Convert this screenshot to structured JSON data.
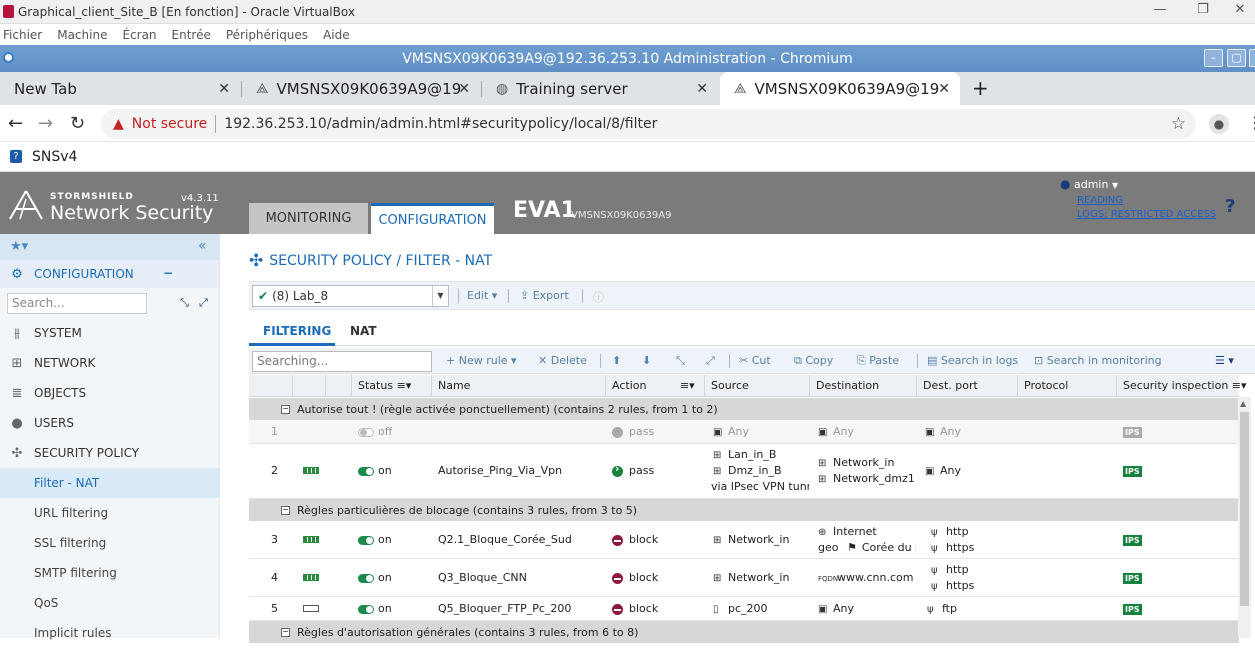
{
  "vbox": {
    "title": "Graphical_client_Site_B [En fonction] - Oracle VirtualBox",
    "menu": [
      "Fichier",
      "Machine",
      "Écran",
      "Entrée",
      "Périphériques",
      "Aide"
    ]
  },
  "chrome": {
    "window_title": "VMSNSX09K0639A9@192.36.253.10 Administration - Chromium",
    "tabs": [
      {
        "label": "New Tab"
      },
      {
        "label": "VMSNSX09K0639A9@19"
      },
      {
        "label": "Training server"
      },
      {
        "label": "VMSNSX09K0639A9@19"
      }
    ],
    "not_secure": "Not secure",
    "url": "192.36.253.10/admin/admin.html#securitypolicy/local/8/filter",
    "bookmark": "SNSv4"
  },
  "sns": {
    "brand_small": "STORMSHIELD",
    "brand_large": "Network Security",
    "version": "v4.3.11",
    "tab_monitoring": "MONITORING",
    "tab_configuration": "CONFIGURATION",
    "firewall_name": "EVA1",
    "serial": "VMSNSX09K0639A9",
    "user": "admin",
    "reading": "READING",
    "logs": "LOGS: RESTRICTED ACCESS",
    "help": "?"
  },
  "sidebar": {
    "section": "CONFIGURATION",
    "search_placeholder": "Search...",
    "items": [
      "SYSTEM",
      "NETWORK",
      "OBJECTS",
      "USERS",
      "SECURITY POLICY"
    ],
    "sub_items": [
      "Filter - NAT",
      "URL filtering",
      "SSL filtering",
      "SMTP filtering",
      "QoS",
      "Implicit rules"
    ]
  },
  "main": {
    "title": "SECURITY POLICY / FILTER - NAT",
    "policy": "(8) Lab_8",
    "edit": "Edit",
    "export": "Export",
    "tab_filtering": "FILTERING",
    "tab_nat": "NAT",
    "search_placeholder": "Searching...",
    "actions": {
      "new_rule": "New rule",
      "delete": "Delete",
      "cut": "Cut",
      "copy": "Copy",
      "paste": "Paste",
      "search_logs": "Search in logs",
      "search_monitoring": "Search in monitoring"
    },
    "columns": {
      "status": "Status",
      "name": "Name",
      "action": "Action",
      "source": "Source",
      "destination": "Destination",
      "dest_port": "Dest. port",
      "protocol": "Protocol",
      "inspection": "Security inspection"
    },
    "groups": [
      "Autorise tout ! (règle activée ponctuellement) (contains 2 rules, from 1 to 2)",
      "Règles particulières de blocage (contains 3 rules, from 3 to 5)",
      "Règles d'autorisation générales (contains 3 rules, from 6 to 8)"
    ],
    "rules": [
      {
        "num": "1",
        "status": "off",
        "name": "",
        "action": "pass",
        "source": "Any",
        "destination": "Any",
        "port": "Any",
        "ips": "IPS"
      },
      {
        "num": "2",
        "status": "on",
        "name": "Autorise_Ping_Via_Vpn",
        "action": "pass",
        "src1": "Lan_in_B",
        "src2": "Dmz_in_B",
        "src3": "via IPsec VPN tunne",
        "dst1": "Network_in",
        "dst2": "Network_dmz1",
        "port": "Any",
        "ips": "IPS"
      },
      {
        "num": "3",
        "status": "on",
        "name": "Q2.1_Bloque_Corée_Sud",
        "action": "block",
        "source": "Network_in",
        "dst1": "Internet",
        "dst2_prefix": "geo",
        "dst2": "Corée du S",
        "port1": "http",
        "port2": "https",
        "ips": "IPS"
      },
      {
        "num": "4",
        "status": "on",
        "name": "Q3_Bloque_CNN",
        "action": "block",
        "source": "Network_in",
        "destination": "www.cnn.com",
        "port1": "http",
        "port2": "https",
        "ips": "IPS"
      },
      {
        "num": "5",
        "status": "on",
        "name": "Q5_Bloquer_FTP_Pc_200",
        "action": "block",
        "source": "pc_200",
        "destination": "Any",
        "port": "ftp",
        "ips": "IPS"
      }
    ]
  }
}
